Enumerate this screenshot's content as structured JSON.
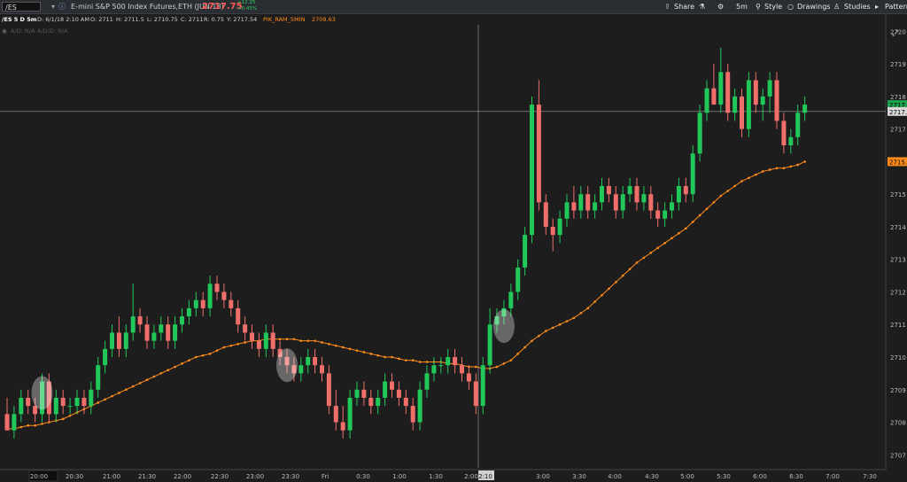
{
  "toolbar": {
    "symbol": "/ES",
    "description": "E-mini S&P 500 Index Futures,ETH (JUN 18)",
    "last_price": "2717.75",
    "net_change": "+12.25",
    "pct_change": "+0.45%",
    "share_label": "Share",
    "timeframe_label": "5m",
    "style_label": "Style",
    "drawings_label": "Drawings",
    "studies_label": "Studies",
    "patterns_label": "Patterns"
  },
  "info": {
    "title": "/ES 5 D 5m",
    "date": "D: 6/1/18 2:10 AM",
    "open": "O: 2711",
    "high": "H: 2711.5",
    "low": "L: 2710.75",
    "close": "C: 2711",
    "range": "R: 0.75",
    "y_value": "Y: 2717.54",
    "study_name": "PIK_RAM_5MIN",
    "study_value": "2709.63",
    "ad_label": "A/D: N/A",
    "adv_label": "A/D/D: N/A"
  },
  "colors": {
    "background": "#1d1d1d",
    "up": "#22c75a",
    "down": "#f16f6b",
    "ma_line": "#ff8c1a",
    "last_price": "#ff5b5b",
    "crosshair": "#a0a0a0"
  },
  "axis": {
    "current_price_label": "2717.",
    "ma_price_label": "2715."
  },
  "chart_data": {
    "type": "candlestick",
    "title": "/ES 5 D 5m",
    "ylim": [
      2706.6,
      2720.2
    ],
    "y_ticks": [
      2707,
      2708,
      2709,
      2710,
      2711,
      2712,
      2713,
      2714,
      2715,
      2716,
      2717,
      2718,
      2719,
      2720
    ],
    "x_ticks": [
      "20:00",
      "20:30",
      "21:00",
      "21:30",
      "22:00",
      "22:30",
      "23:00",
      "23:30",
      "Fri",
      "0:30",
      "1:00",
      "1:30",
      "2:00",
      "2:10",
      "3:00",
      "3:30",
      "4:00",
      "4:30",
      "5:00",
      "5:30",
      "6:00",
      "6:30",
      "7:00",
      "7:30"
    ],
    "crosshair": {
      "time": "2:10",
      "price": 2717.54
    },
    "candles": [
      [
        2708.25,
        2708.75,
        2707.75,
        2707.75
      ],
      [
        2707.75,
        2708.5,
        2707.5,
        2708.25
      ],
      [
        2708.25,
        2709,
        2708,
        2708.75
      ],
      [
        2708.75,
        2709,
        2708.25,
        2708.5
      ],
      [
        2708.5,
        2708.75,
        2708,
        2708.25
      ],
      [
        2708.25,
        2709.5,
        2708,
        2709.25
      ],
      [
        2709.25,
        2709.5,
        2708,
        2708.25
      ],
      [
        2708.25,
        2709,
        2708,
        2708.75
      ],
      [
        2708.75,
        2709,
        2708.25,
        2708.5
      ],
      [
        2708.5,
        2708.75,
        2708.25,
        2708.5
      ],
      [
        2708.5,
        2709,
        2708.25,
        2708.75
      ],
      [
        2708.75,
        2709,
        2708.25,
        2708.5
      ],
      [
        2708.5,
        2709.25,
        2708.25,
        2709
      ],
      [
        2709,
        2710,
        2708.75,
        2709.75
      ],
      [
        2709.75,
        2710.5,
        2709.5,
        2710.25
      ],
      [
        2710.25,
        2711,
        2710,
        2710.75
      ],
      [
        2710.75,
        2711.25,
        2710,
        2710.25
      ],
      [
        2710.25,
        2711,
        2710,
        2710.75
      ],
      [
        2710.75,
        2712.25,
        2710.5,
        2711.25
      ],
      [
        2711.25,
        2711.5,
        2710.75,
        2711
      ],
      [
        2711,
        2711.25,
        2710.25,
        2710.5
      ],
      [
        2710.5,
        2711,
        2710.25,
        2710.75
      ],
      [
        2710.75,
        2711.25,
        2710.5,
        2711
      ],
      [
        2711,
        2711.25,
        2710.25,
        2710.5
      ],
      [
        2710.5,
        2711.25,
        2710.25,
        2711
      ],
      [
        2711,
        2711.5,
        2710.75,
        2711.25
      ],
      [
        2711.25,
        2711.75,
        2711,
        2711.5
      ],
      [
        2711.5,
        2712,
        2711.25,
        2711.75
      ],
      [
        2711.75,
        2712,
        2711.25,
        2711.5
      ],
      [
        2711.5,
        2712.5,
        2711.25,
        2712.25
      ],
      [
        2712.25,
        2712.5,
        2711.75,
        2712
      ],
      [
        2712,
        2712.25,
        2711.5,
        2711.75
      ],
      [
        2711.75,
        2712,
        2711.25,
        2711.5
      ],
      [
        2711.5,
        2711.75,
        2710.75,
        2711
      ],
      [
        2711,
        2711.25,
        2710.5,
        2710.75
      ],
      [
        2710.75,
        2711,
        2710.25,
        2710.5
      ],
      [
        2710.5,
        2710.75,
        2710,
        2710.25
      ],
      [
        2710.25,
        2711,
        2710,
        2710.75
      ],
      [
        2710.75,
        2711,
        2710,
        2710.25
      ],
      [
        2710.25,
        2710.5,
        2709.75,
        2710
      ],
      [
        2710,
        2710.25,
        2709.5,
        2709.75
      ],
      [
        2709.75,
        2710,
        2709.25,
        2709.5
      ],
      [
        2709.5,
        2710,
        2709.25,
        2709.75
      ],
      [
        2709.75,
        2710.25,
        2709.5,
        2710
      ],
      [
        2710,
        2710.25,
        2709.5,
        2709.75
      ],
      [
        2709.75,
        2710,
        2709.25,
        2709.5
      ],
      [
        2709.5,
        2709.75,
        2708.25,
        2708.5
      ],
      [
        2708.5,
        2709,
        2707.75,
        2708
      ],
      [
        2708,
        2708.5,
        2707.5,
        2707.75
      ],
      [
        2707.75,
        2709,
        2707.5,
        2708.75
      ],
      [
        2708.75,
        2709.25,
        2708.5,
        2709
      ],
      [
        2709,
        2709.25,
        2708.5,
        2708.75
      ],
      [
        2708.75,
        2709,
        2708.25,
        2708.5
      ],
      [
        2708.5,
        2709,
        2708.25,
        2708.75
      ],
      [
        2708.75,
        2709.5,
        2708.5,
        2709.25
      ],
      [
        2709.25,
        2709.5,
        2708.75,
        2709
      ],
      [
        2709,
        2709.25,
        2708.5,
        2708.75
      ],
      [
        2708.75,
        2709,
        2708.25,
        2708.5
      ],
      [
        2708.5,
        2708.75,
        2707.75,
        2708
      ],
      [
        2708,
        2709.25,
        2707.75,
        2709
      ],
      [
        2709,
        2709.75,
        2708.75,
        2709.5
      ],
      [
        2709.5,
        2710,
        2709.25,
        2709.75
      ],
      [
        2709.75,
        2710,
        2709.5,
        2709.75
      ],
      [
        2709.75,
        2710.25,
        2709.5,
        2710
      ],
      [
        2710,
        2710.25,
        2709.5,
        2709.75
      ],
      [
        2709.75,
        2710,
        2709.25,
        2709.5
      ],
      [
        2709.5,
        2709.75,
        2709,
        2709.25
      ],
      [
        2709.25,
        2709.5,
        2708.25,
        2708.5
      ],
      [
        2708.5,
        2710,
        2708.25,
        2709.75
      ],
      [
        2709.75,
        2711.5,
        2709.5,
        2711
      ],
      [
        2711,
        2711.5,
        2710.75,
        2711.25
      ],
      [
        2711.25,
        2711.75,
        2711,
        2711.5
      ],
      [
        2711.5,
        2712.25,
        2711.25,
        2712
      ],
      [
        2712,
        2713,
        2711.75,
        2712.75
      ],
      [
        2712.75,
        2714,
        2712.5,
        2713.75
      ],
      [
        2713.75,
        2718,
        2713.5,
        2717.75
      ],
      [
        2717.75,
        2718.5,
        2714.5,
        2714.75
      ],
      [
        2714.75,
        2715,
        2713.75,
        2714
      ],
      [
        2714,
        2714.25,
        2713.25,
        2713.75
      ],
      [
        2713.75,
        2714.5,
        2713.5,
        2714.25
      ],
      [
        2714.25,
        2715,
        2714,
        2714.75
      ],
      [
        2714.75,
        2715.25,
        2714.25,
        2714.5
      ],
      [
        2714.5,
        2715.25,
        2714.25,
        2715
      ],
      [
        2715,
        2715.25,
        2714.25,
        2714.5
      ],
      [
        2714.5,
        2715,
        2714.25,
        2714.75
      ],
      [
        2714.75,
        2715.5,
        2714.5,
        2715.25
      ],
      [
        2715.25,
        2715.5,
        2714.75,
        2715
      ],
      [
        2715,
        2715.25,
        2714.25,
        2714.5
      ],
      [
        2714.5,
        2715.25,
        2714.25,
        2715
      ],
      [
        2715,
        2715.5,
        2714.75,
        2715.25
      ],
      [
        2715.25,
        2715.5,
        2714.5,
        2714.75
      ],
      [
        2714.75,
        2715.25,
        2714.5,
        2715
      ],
      [
        2715,
        2715.25,
        2714.25,
        2714.5
      ],
      [
        2714.5,
        2714.75,
        2714,
        2714.25
      ],
      [
        2714.25,
        2714.75,
        2714,
        2714.5
      ],
      [
        2714.5,
        2715,
        2714.25,
        2714.75
      ],
      [
        2714.75,
        2715.5,
        2714.5,
        2715.25
      ],
      [
        2715.25,
        2715.5,
        2714.75,
        2715
      ],
      [
        2715,
        2716.5,
        2714.75,
        2716.25
      ],
      [
        2716.25,
        2717.75,
        2716,
        2717.5
      ],
      [
        2717.5,
        2718.5,
        2717.25,
        2718.25
      ],
      [
        2718.25,
        2719,
        2717.75,
        2717.75
      ],
      [
        2717.75,
        2719.5,
        2717.5,
        2718.75
      ],
      [
        2718.75,
        2719,
        2717.25,
        2717.5
      ],
      [
        2717.5,
        2718.25,
        2717.25,
        2718
      ],
      [
        2718,
        2718.25,
        2716.75,
        2717
      ],
      [
        2717,
        2718.75,
        2716.75,
        2718.5
      ],
      [
        2718.5,
        2718.75,
        2717.5,
        2717.75
      ],
      [
        2717.75,
        2718.25,
        2717.25,
        2718
      ],
      [
        2718,
        2718.75,
        2717.5,
        2718.5
      ],
      [
        2718.5,
        2718.75,
        2717,
        2717.25
      ],
      [
        2717.25,
        2717.5,
        2716.25,
        2716.5
      ],
      [
        2716.5,
        2717,
        2716.25,
        2716.75
      ],
      [
        2716.75,
        2717.75,
        2716.5,
        2717.5
      ],
      [
        2717.5,
        2718,
        2717.25,
        2717.75
      ]
    ],
    "series": [
      {
        "name": "PIK_RAM_5MIN",
        "values": [
          2707.8,
          2707.8,
          2707.85,
          2707.9,
          2707.9,
          2707.95,
          2708.0,
          2708.05,
          2708.1,
          2708.2,
          2708.3,
          2708.4,
          2708.5,
          2708.6,
          2708.7,
          2708.8,
          2708.9,
          2709.0,
          2709.1,
          2709.2,
          2709.3,
          2709.4,
          2709.5,
          2709.6,
          2709.7,
          2709.8,
          2709.9,
          2710.0,
          2710.05,
          2710.1,
          2710.2,
          2710.3,
          2710.35,
          2710.4,
          2710.45,
          2710.5,
          2710.5,
          2710.55,
          2710.55,
          2710.55,
          2710.55,
          2710.55,
          2710.5,
          2710.5,
          2710.5,
          2710.45,
          2710.4,
          2710.35,
          2710.3,
          2710.25,
          2710.2,
          2710.15,
          2710.1,
          2710.05,
          2710.0,
          2710.0,
          2709.95,
          2709.9,
          2709.9,
          2709.85,
          2709.85,
          2709.85,
          2709.85,
          2709.8,
          2709.8,
          2709.75,
          2709.7,
          2709.7,
          2709.65,
          2709.65,
          2709.7,
          2709.8,
          2709.9,
          2710.1,
          2710.3,
          2710.5,
          2710.65,
          2710.8,
          2710.9,
          2711.0,
          2711.1,
          2711.2,
          2711.35,
          2711.5,
          2711.7,
          2711.9,
          2712.1,
          2712.3,
          2712.5,
          2712.7,
          2712.9,
          2713.05,
          2713.2,
          2713.35,
          2713.5,
          2713.65,
          2713.8,
          2713.95,
          2714.15,
          2714.35,
          2714.55,
          2714.75,
          2714.95,
          2715.1,
          2715.25,
          2715.4,
          2715.5,
          2715.6,
          2715.7,
          2715.75,
          2715.8,
          2715.8,
          2715.85,
          2715.9,
          2716.0
        ]
      }
    ],
    "highlights": [
      {
        "index": 5,
        "price": 2708.9
      },
      {
        "index": 40,
        "price": 2709.75
      },
      {
        "index": 71,
        "price": 2710.95
      }
    ]
  }
}
